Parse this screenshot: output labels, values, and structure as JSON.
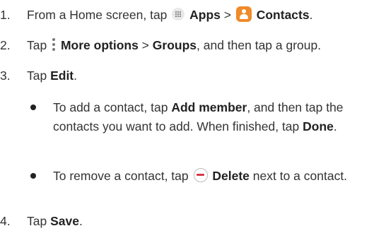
{
  "steps": [
    {
      "num": "1.",
      "text": [
        "From a Home screen, tap ",
        " ",
        " > ",
        " ",
        "."
      ],
      "bold": [
        "Apps",
        "Contacts"
      ]
    },
    {
      "num": "2.",
      "text": [
        "Tap ",
        " ",
        " > ",
        ", and then tap a group."
      ],
      "bold": [
        "More options",
        "Groups"
      ]
    },
    {
      "num": "3.",
      "text": [
        "Tap ",
        "."
      ],
      "bold": [
        "Edit"
      ]
    },
    {
      "num": "4.",
      "text": [
        "Tap ",
        "."
      ],
      "bold": [
        "Save"
      ]
    }
  ],
  "bullets": [
    {
      "text": [
        "To add a contact, tap ",
        ", and then tap the contacts you want to add. When finished, tap ",
        "."
      ],
      "bold": [
        "Add member",
        "Done"
      ]
    },
    {
      "text": [
        "To remove a contact, tap ",
        " ",
        " next to a contact."
      ],
      "bold": [
        "Delete"
      ]
    }
  ],
  "icons": [
    "apps-icon",
    "contacts-icon",
    "more-options-icon",
    "delete-icon"
  ],
  "colors": {
    "contacts_icon": "#f08a2a",
    "delete_minus": "#d53a4a"
  }
}
